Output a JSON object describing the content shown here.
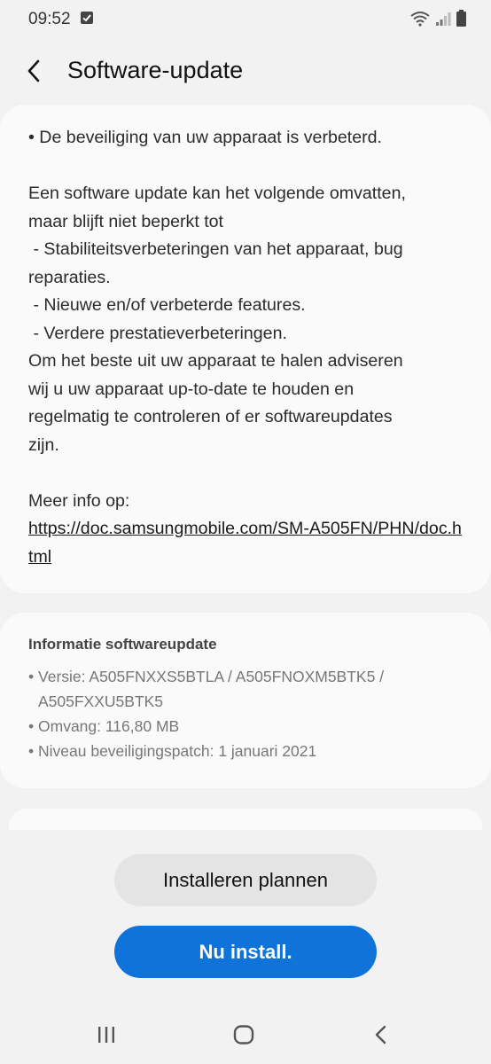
{
  "status_bar": {
    "time": "09:52"
  },
  "app_bar": {
    "title": "Software-update"
  },
  "notes": {
    "text": "• De beveiliging van uw apparaat is verbeterd.\n\nEen software update kan het volgende omvatten,\nmaar blijft niet beperkt tot\n - Stabiliteitsverbeteringen van het apparaat, bug\nreparaties.\n - Nieuwe en/of verbeterde features.\n - Verdere prestatieverbeteringen.\nOm het beste uit uw apparaat te halen adviseren\nwij u uw apparaat up-to-date te houden en\nregelmatig te controleren of er softwareupdates\nzijn.\n\nMeer info op:",
    "link": "https://doc.samsungmobile.com/SM-A505FN/PHN/doc.html"
  },
  "info": {
    "title": "Informatie softwareupdate",
    "version_line1": "Versie: A505FNXXS5BTLA / A505FNOXM5BTK5 /",
    "version_line2": "A505FXXU5BTK5",
    "size": "Omvang: 116,80 MB",
    "patch": "Niveau beveiligingspatch: 1 januari 2021"
  },
  "buttons": {
    "schedule": "Installeren plannen",
    "install_now": "Nu install."
  },
  "colors": {
    "primary": "#0f73d9",
    "background": "#f2f2f2",
    "card": "#fafafa"
  },
  "icons": [
    "checkbox-notification-icon",
    "wifi-icon",
    "signal-icon",
    "battery-icon",
    "back-arrow-icon",
    "recent-apps-icon",
    "home-icon",
    "nav-back-icon"
  ]
}
